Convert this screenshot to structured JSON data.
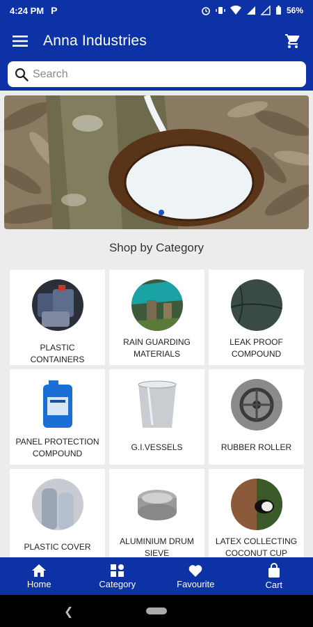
{
  "status": {
    "time": "4:24 PM",
    "app_icon": "P",
    "battery": "56%"
  },
  "appbar": {
    "title": "Anna Industries",
    "menu_icon": "hamburger-icon",
    "cart_icon": "cart-icon"
  },
  "search": {
    "placeholder": "Search",
    "value": ""
  },
  "section": {
    "title": "Shop by Category"
  },
  "categories": [
    {
      "label": "PLASTIC CONTAINERS"
    },
    {
      "label": "RAIN GUARDING MATERIALS"
    },
    {
      "label": "LEAK PROOF COMPOUND"
    },
    {
      "label": "PANEL PROTECTION COMPOUND"
    },
    {
      "label": "G.I.VESSELS"
    },
    {
      "label": "RUBBER ROLLER"
    },
    {
      "label": "PLASTIC COVER"
    },
    {
      "label": "ALUMINIUM DRUM SIEVE"
    },
    {
      "label": "LATEX COLLECTING COCONUT CUP"
    }
  ],
  "nav": [
    {
      "label": "Home",
      "icon": "home-icon"
    },
    {
      "label": "Category",
      "icon": "category-icon"
    },
    {
      "label": "Favourite",
      "icon": "heart-icon"
    },
    {
      "label": "Cart",
      "icon": "bag-icon"
    }
  ],
  "colors": {
    "primary": "#0d32a6",
    "background": "#ececec"
  }
}
